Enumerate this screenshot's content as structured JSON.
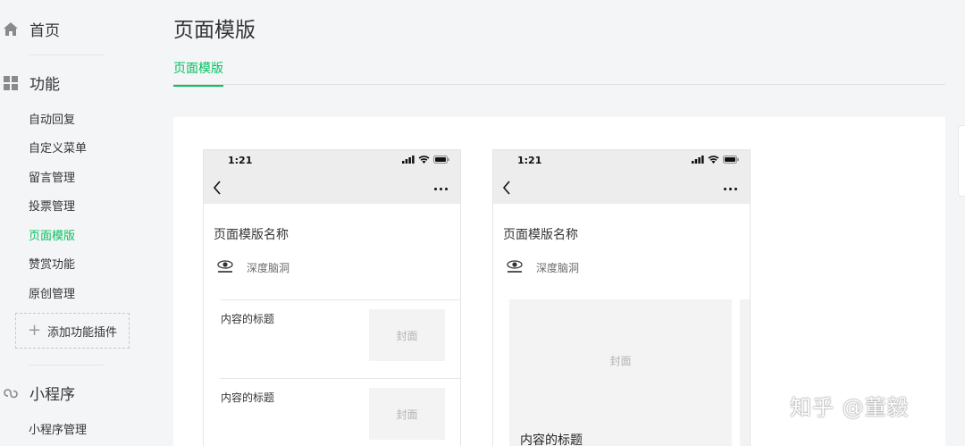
{
  "sidebar": {
    "home_label": "首页",
    "function_label": "功能",
    "function_items": [
      {
        "label": "自动回复",
        "active": false
      },
      {
        "label": "自定义菜单",
        "active": false
      },
      {
        "label": "留言管理",
        "active": false
      },
      {
        "label": "投票管理",
        "active": false
      },
      {
        "label": "页面模版",
        "active": true
      },
      {
        "label": "赞赏功能",
        "active": false
      },
      {
        "label": "原创管理",
        "active": false
      }
    ],
    "add_plugin_label": "添加功能插件",
    "mini_program_label": "小程序",
    "mini_program_items": [
      {
        "label": "小程序管理"
      }
    ]
  },
  "main": {
    "page_title": "页面模版",
    "tabs": [
      {
        "label": "页面模版",
        "active": true
      }
    ]
  },
  "phones": [
    {
      "time": "1:21",
      "title": "页面模版名称",
      "account_name": "深度脑洞",
      "layout": "list",
      "rows": [
        {
          "title": "内容的标题",
          "cover": "封面"
        },
        {
          "title": "内容的标题",
          "cover": "封面"
        }
      ]
    },
    {
      "time": "1:21",
      "title": "页面模版名称",
      "account_name": "深度脑洞",
      "layout": "card",
      "card": {
        "cover": "封面",
        "title": "内容的标题"
      }
    }
  ],
  "watermark": "知乎 @董毅",
  "colors": {
    "accent": "#07c160",
    "text": "#353535",
    "background": "#f4f5f7",
    "placeholder_text": "#b4b4b4"
  },
  "icons": {
    "home": "home-icon",
    "function": "grid-icon",
    "mini_program": "mini-program-icon",
    "back": "chevron-left-icon",
    "more": "more-dots-icon"
  }
}
